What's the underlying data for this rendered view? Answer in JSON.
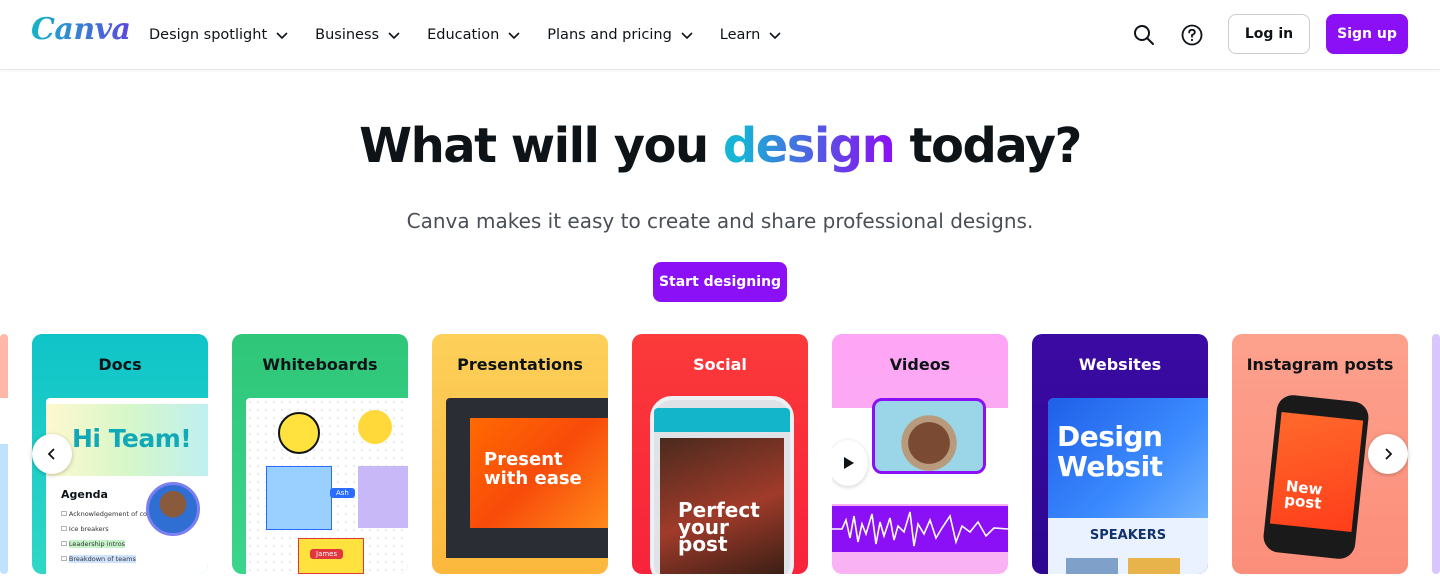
{
  "brand": {
    "logo_text": "Canva",
    "accent": "#8b10f5",
    "teal": "#16b5c6"
  },
  "nav": {
    "items": [
      {
        "label": "Design spotlight"
      },
      {
        "label": "Business"
      },
      {
        "label": "Education"
      },
      {
        "label": "Plans and pricing"
      },
      {
        "label": "Learn"
      }
    ],
    "search_icon": "search-icon",
    "help_icon": "help-icon",
    "login_label": "Log in",
    "signup_label": "Sign up"
  },
  "hero": {
    "title_before": "What will you ",
    "title_highlight": "design",
    "title_after": " today?",
    "subtitle": "Canva makes it easy to create and share professional designs.",
    "cta_label": "Start designing"
  },
  "cards": [
    {
      "label": "Docs",
      "color": "#12c4c8",
      "art": {
        "banner": "Hi Team!",
        "heading": "Agenda",
        "items": [
          "Acknowledgement of cou",
          "Ice breakers",
          "Leadership intros",
          "Breakdown of teams"
        ]
      }
    },
    {
      "label": "Whiteboards",
      "color": "#3fcb7e",
      "art": {
        "tags": [
          "Ash",
          "James"
        ]
      }
    },
    {
      "label": "Presentations",
      "color": "#fdc34a",
      "art": {
        "slide_text": "Present with ease"
      }
    },
    {
      "label": "Social",
      "color": "#fa3c3c",
      "art": {
        "post_text": "Perfect your post"
      }
    },
    {
      "label": "Videos",
      "color": "#fea5f5",
      "art": {}
    },
    {
      "label": "Websites",
      "color": "#3a0ca3",
      "art": {
        "site_title": "Design Websit",
        "site_section": "SPEAKERS"
      }
    },
    {
      "label": "Instagram posts",
      "color": "#fda18d",
      "art": {
        "post_text": "New post"
      }
    }
  ],
  "carousel": {
    "prev_icon": "chevron-left-icon",
    "next_icon": "chevron-right-icon"
  }
}
